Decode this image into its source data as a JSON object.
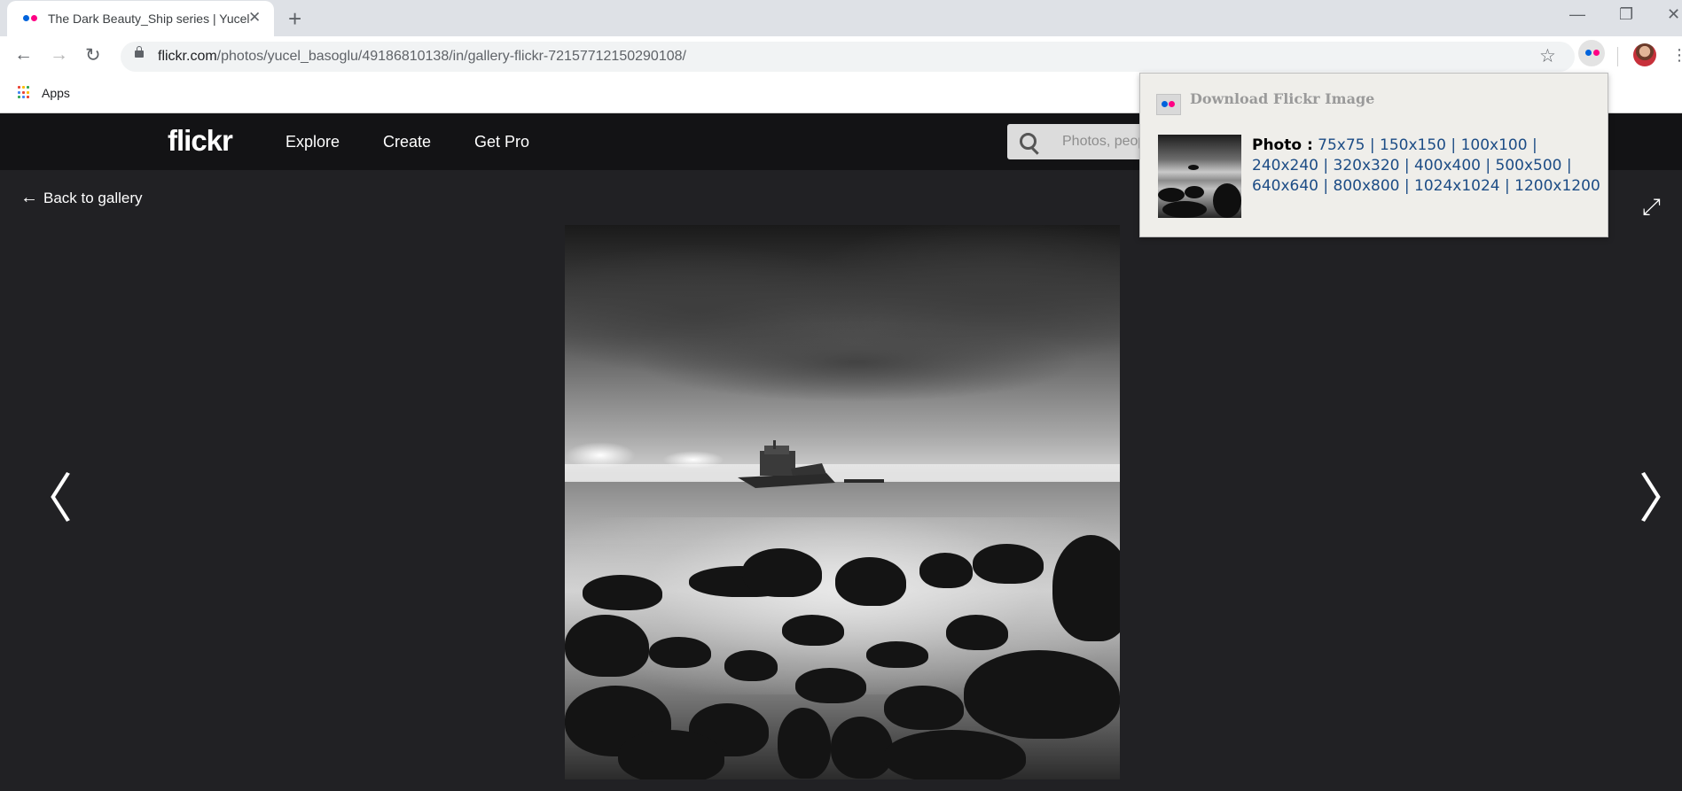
{
  "browser": {
    "tab_title": "The Dark Beauty_Ship series | Yucel Basoglu",
    "url_host": "flickr.com",
    "url_path": "/photos/yucel_basoglu/49186810138/in/gallery-flickr-72157712150290108/",
    "bookmark_apps": "Apps",
    "icons": [
      "back-arrow-icon",
      "forward-arrow-icon",
      "reload-icon",
      "lock-icon",
      "star-icon",
      "flickr-extension-icon",
      "profile-avatar",
      "menu-icon"
    ]
  },
  "flickr": {
    "logo": "flickr",
    "nav": [
      "Explore",
      "Create",
      "Get Pro"
    ],
    "search_placeholder": "Photos, people, or groups",
    "back_label": "Back to gallery",
    "colors": {
      "blue": "#0063dc",
      "pink": "#ff0084",
      "nav_bg": "#131315",
      "page_bg": "#212124"
    }
  },
  "extension_popup": {
    "title": "Download Flickr Image",
    "label": "Photo :",
    "sizes": [
      "75x75",
      "150x150",
      "100x100",
      "240x240",
      "320x320",
      "400x400",
      "500x500",
      "640x640",
      "800x800",
      "1024x1024",
      "1200x1200"
    ]
  }
}
